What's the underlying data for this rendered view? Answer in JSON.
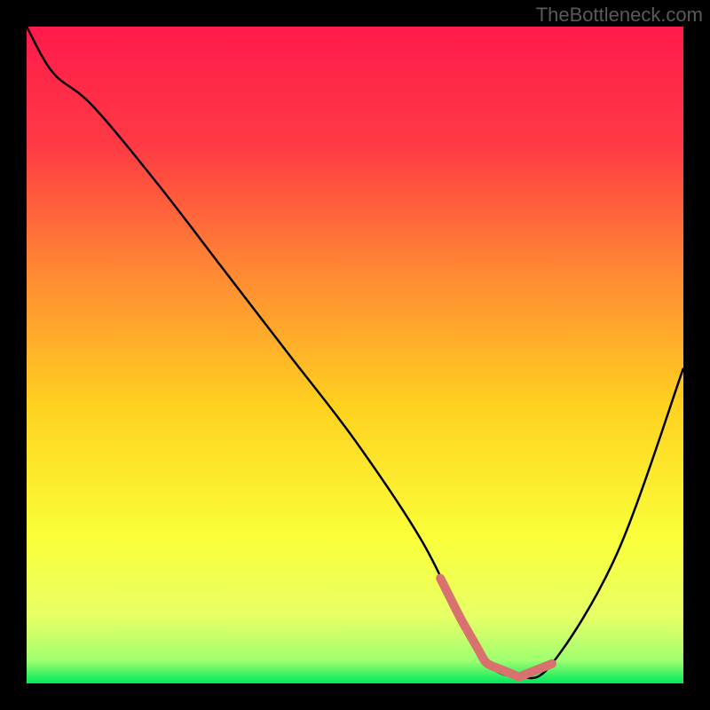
{
  "watermark": "TheBottleneck.com",
  "chart_data": {
    "type": "line",
    "title": "",
    "xlabel": "",
    "ylabel": "",
    "xlim": [
      0,
      100
    ],
    "ylim": [
      0,
      100
    ],
    "grid": false,
    "series": [
      {
        "name": "bottleneck-curve",
        "x": [
          0,
          4,
          10,
          20,
          30,
          40,
          50,
          60,
          66,
          70,
          75,
          80,
          90,
          100
        ],
        "values": [
          100,
          93,
          88,
          76,
          63,
          50,
          37,
          22,
          10,
          3,
          1,
          3,
          20,
          48
        ]
      }
    ],
    "highlight_region": {
      "name": "optimal-zone",
      "x_range": [
        63,
        80
      ],
      "style": "thick-salmon"
    },
    "gradient_stops": [
      {
        "offset": 0.0,
        "color": "#ff1a4b"
      },
      {
        "offset": 0.18,
        "color": "#ff3a44"
      },
      {
        "offset": 0.38,
        "color": "#ff8b33"
      },
      {
        "offset": 0.58,
        "color": "#ffd21f"
      },
      {
        "offset": 0.78,
        "color": "#faff3a"
      },
      {
        "offset": 0.9,
        "color": "#e6ff66"
      },
      {
        "offset": 0.965,
        "color": "#9fff70"
      },
      {
        "offset": 1.0,
        "color": "#00e85c"
      }
    ],
    "colors": {
      "curve": "#000000",
      "highlight": "#d9716e",
      "background": "#000000"
    }
  }
}
